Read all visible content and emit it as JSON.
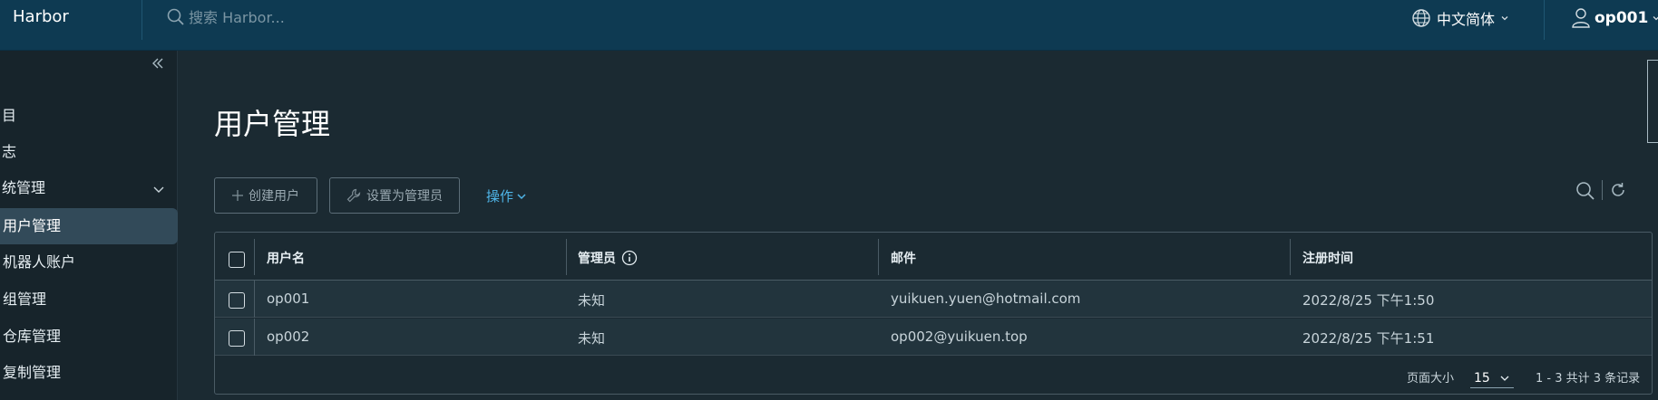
{
  "header": {
    "brand": "Harbor",
    "search_placeholder": "搜索 Harbor...",
    "language": "中文简体",
    "user": "op001"
  },
  "sidebar": {
    "items": [
      {
        "label": "目"
      },
      {
        "label": "志"
      },
      {
        "label": "统管理"
      },
      {
        "label": "用户管理"
      },
      {
        "label": "机器人账户"
      },
      {
        "label": "组管理"
      },
      {
        "label": "仓库管理"
      },
      {
        "label": "复制管理"
      }
    ]
  },
  "main": {
    "title": "用户管理",
    "create_user": "创建用户",
    "set_admin": "设置为管理员",
    "actions": "操作"
  },
  "table": {
    "columns": [
      "用户名",
      "管理员",
      "邮件",
      "注册时间"
    ],
    "rows": [
      {
        "username": "op001",
        "admin": "未知",
        "email": "yuikuen.yuen@hotmail.com",
        "registered": "2022/8/25 下午1:50"
      },
      {
        "username": "op002",
        "admin": "未知",
        "email": "op002@yuikuen.top",
        "registered": "2022/8/25 下午1:51"
      }
    ],
    "footer": {
      "page_size_label": "页面大小",
      "page_size": "15",
      "summary": "1 - 3 共计 3 条记录"
    }
  },
  "colors": {
    "header_bg": "#0e3a52",
    "page_bg": "#1b2a32",
    "link": "#4fb5e8",
    "active_nav": "#324a59"
  }
}
